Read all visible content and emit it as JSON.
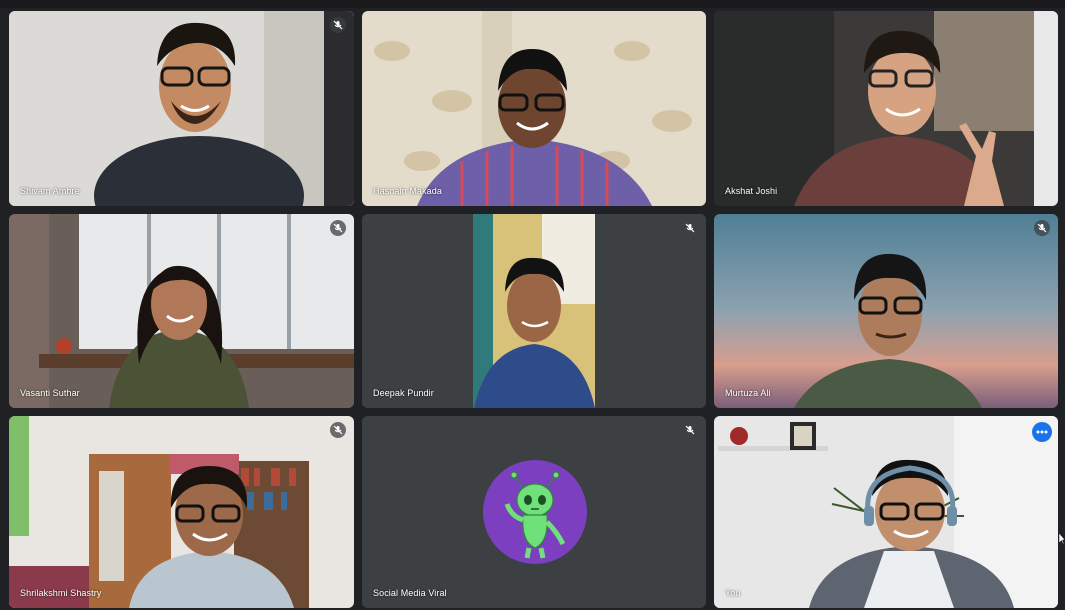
{
  "participants": [
    {
      "name": "Shivam Ambre",
      "muted": true
    },
    {
      "name": "Hasnain Makada",
      "muted": false
    },
    {
      "name": "Akshat Joshi",
      "muted": false
    },
    {
      "name": "Vasanti Suthar",
      "muted": true
    },
    {
      "name": "Deepak Pundir",
      "muted": true
    },
    {
      "name": "Murtuza Ali",
      "muted": true
    },
    {
      "name": "Shrilakshmi Shastry",
      "muted": true
    },
    {
      "name": "Social Media Viral",
      "muted": true
    },
    {
      "name": "You",
      "muted": false
    }
  ],
  "icons": {
    "mic_muted": "mic-off-icon",
    "more": "more-options-icon",
    "avatar": "alien-avatar-icon"
  },
  "colors": {
    "tile_bg": "#3c4043",
    "active_border": "#8ab4f8",
    "more_button": "#1a73e8",
    "avatar_bg": "#7b3fbf",
    "avatar_fg": "#6fe07a"
  }
}
